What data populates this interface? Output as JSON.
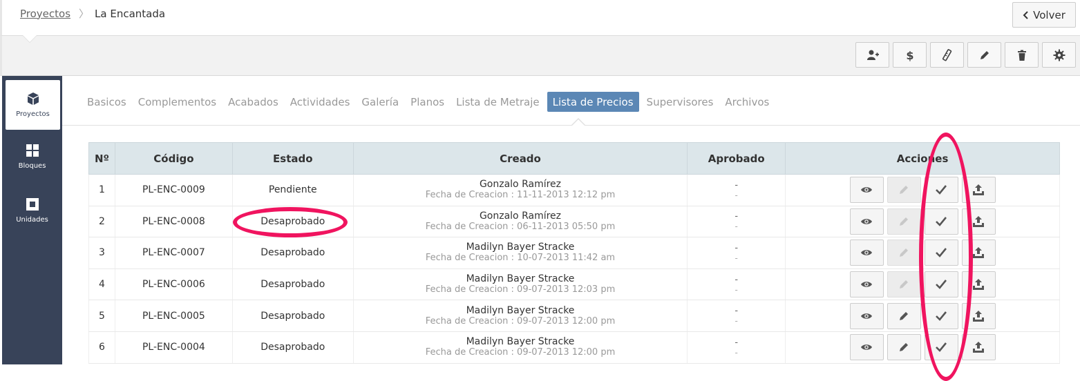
{
  "breadcrumb": {
    "root": "Proyectos",
    "separator": "〉",
    "current": "La Encantada"
  },
  "header": {
    "back_label": "Volver",
    "back_icon": "chevron-left-icon"
  },
  "toolbar": {
    "buttons": [
      {
        "name": "add-user-button",
        "icon": "user-plus-icon"
      },
      {
        "name": "price-button",
        "icon": "dollar-icon"
      },
      {
        "name": "measure-button",
        "icon": "ruler-icon"
      },
      {
        "name": "edit-button",
        "icon": "pencil-icon"
      },
      {
        "name": "delete-button",
        "icon": "trash-icon"
      },
      {
        "name": "settings-button",
        "icon": "gear-icon"
      }
    ]
  },
  "sidebar": {
    "items": [
      {
        "label": "Proyectos",
        "icon": "cube-icon",
        "active": true
      },
      {
        "label": "Bloques",
        "icon": "grid-icon",
        "active": false
      },
      {
        "label": "Unidades",
        "icon": "square-icon",
        "active": false
      }
    ]
  },
  "tabs": [
    {
      "label": "Basicos",
      "active": false
    },
    {
      "label": "Complementos",
      "active": false
    },
    {
      "label": "Acabados",
      "active": false
    },
    {
      "label": "Actividades",
      "active": false
    },
    {
      "label": "Galería",
      "active": false
    },
    {
      "label": "Planos",
      "active": false
    },
    {
      "label": "Lista de Metraje",
      "active": false
    },
    {
      "label": "Lista de Precios",
      "active": true
    },
    {
      "label": "Supervisores",
      "active": false
    },
    {
      "label": "Archivos",
      "active": false
    }
  ],
  "table": {
    "columns": [
      "Nº",
      "Código",
      "Estado",
      "Creado",
      "Aprobado",
      "Acciones"
    ],
    "date_prefix": "Fecha de Creacion : ",
    "rows": [
      {
        "n": "1",
        "codigo": "PL-ENC-0009",
        "estado": "Pendiente",
        "creado_por": "Gonzalo Ramírez",
        "fecha": "Fecha de Creacion : 11-11-2013 12:12 pm",
        "aprobado": "-",
        "aprobado_fecha": "-",
        "edit_enabled": false
      },
      {
        "n": "2",
        "codigo": "PL-ENC-0008",
        "estado": "Desaprobado",
        "creado_por": "Gonzalo Ramírez",
        "fecha": "Fecha de Creacion : 06-11-2013 05:50 pm",
        "aprobado": "-",
        "aprobado_fecha": "-",
        "edit_enabled": false
      },
      {
        "n": "3",
        "codigo": "PL-ENC-0007",
        "estado": "Desaprobado",
        "creado_por": "Madilyn Bayer Stracke",
        "fecha": "Fecha de Creacion : 10-07-2013 11:42 am",
        "aprobado": "-",
        "aprobado_fecha": "-",
        "edit_enabled": false
      },
      {
        "n": "4",
        "codigo": "PL-ENC-0006",
        "estado": "Desaprobado",
        "creado_por": "Madilyn Bayer Stracke",
        "fecha": "Fecha de Creacion : 09-07-2013 12:03 pm",
        "aprobado": "-",
        "aprobado_fecha": "-",
        "edit_enabled": false
      },
      {
        "n": "5",
        "codigo": "PL-ENC-0005",
        "estado": "Desaprobado",
        "creado_por": "Madilyn Bayer Stracke",
        "fecha": "Fecha de Creacion : 09-07-2013 12:00 pm",
        "aprobado": "-",
        "aprobado_fecha": "-",
        "edit_enabled": true
      },
      {
        "n": "6",
        "codigo": "PL-ENC-0004",
        "estado": "Desaprobado",
        "creado_por": "Madilyn Bayer Stracke",
        "fecha": "Fecha de Creacion : 09-07-2013 12:00 pm",
        "aprobado": "-",
        "aprobado_fecha": "-",
        "edit_enabled": true
      }
    ],
    "action_icons": [
      "eye-icon",
      "pencil-icon",
      "check-icon",
      "upload-icon"
    ]
  },
  "colors": {
    "sidebar_bg": "#384359",
    "active_tab": "#5b87b5",
    "table_header": "#dce6ea",
    "annotation": "#f0145f"
  }
}
